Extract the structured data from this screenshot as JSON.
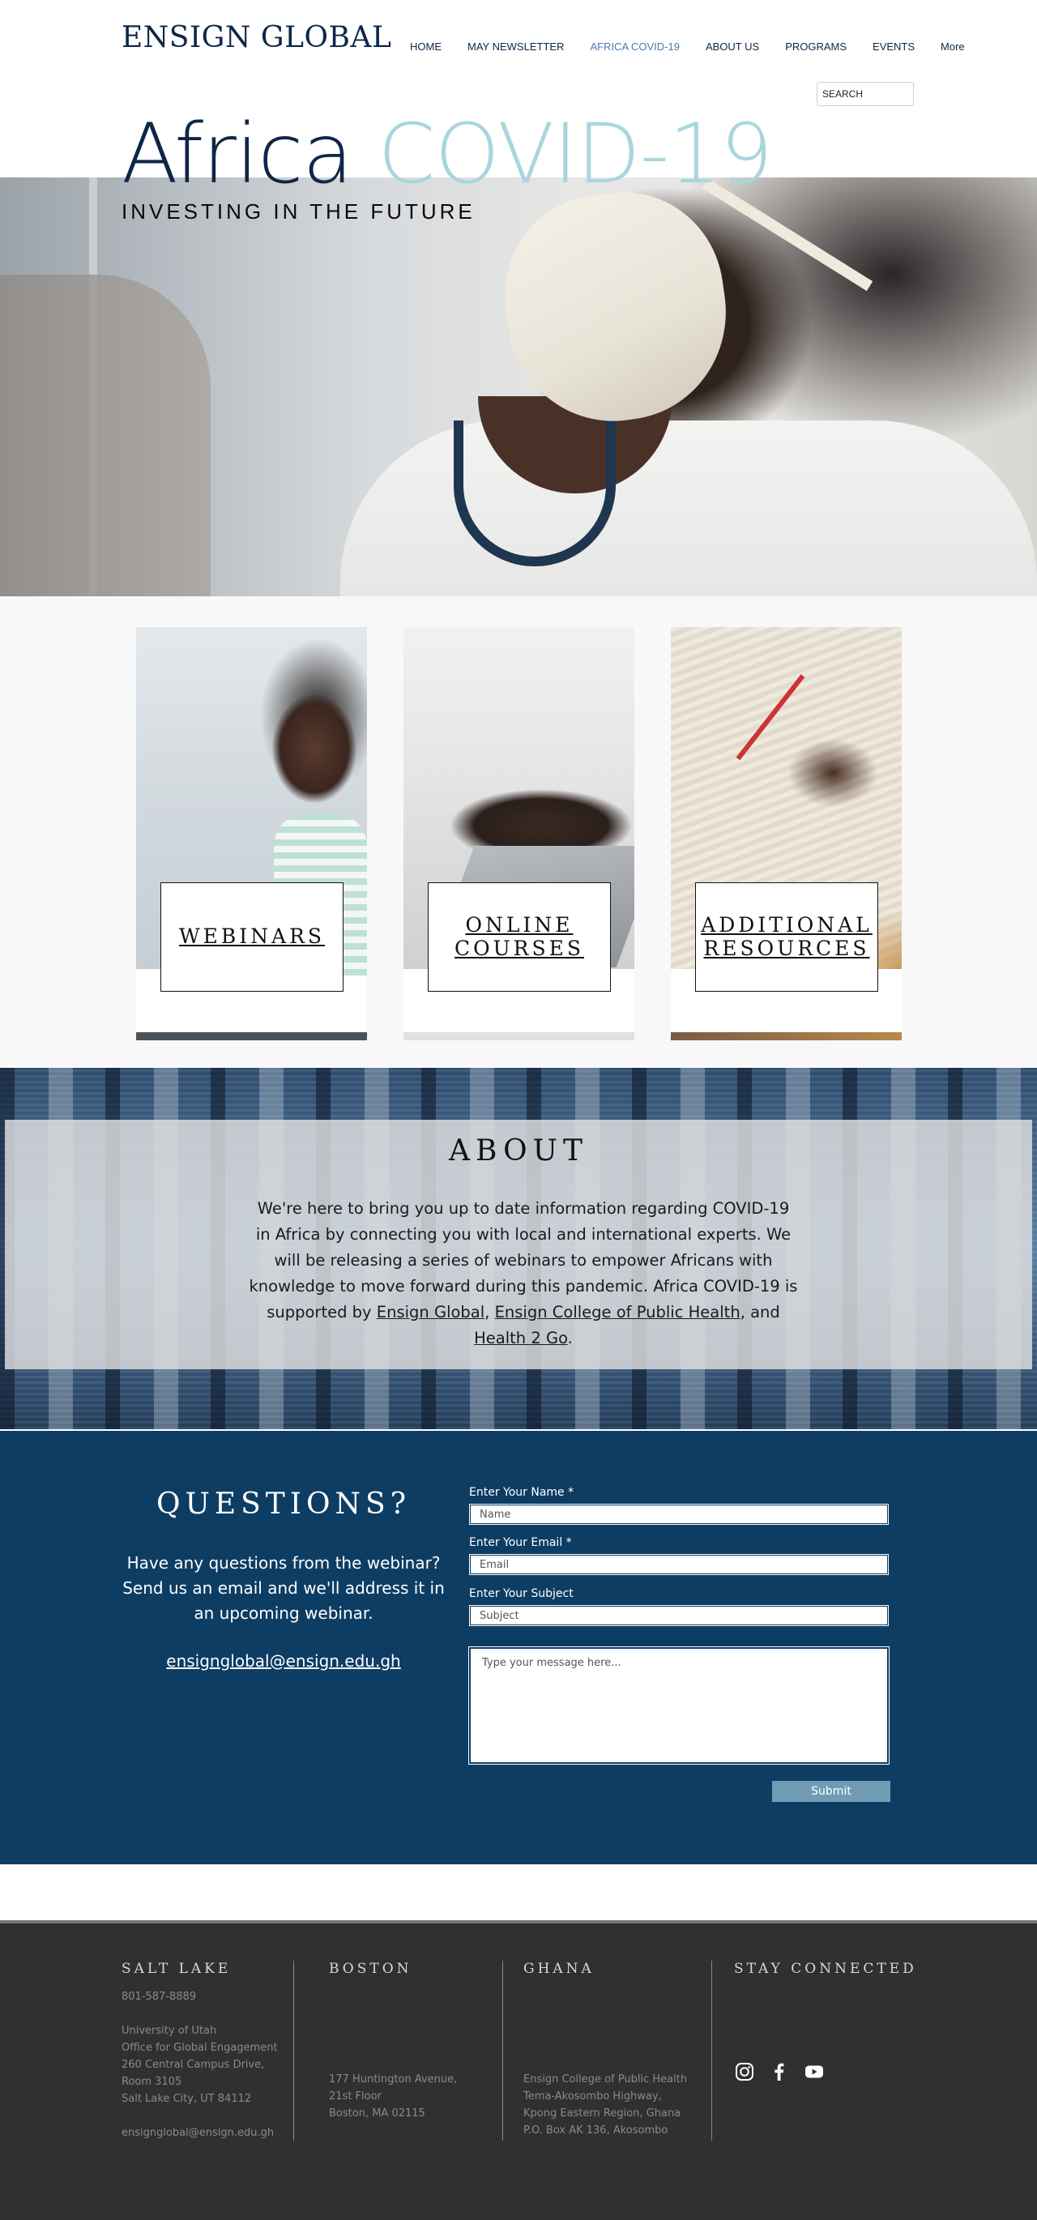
{
  "header": {
    "logo": "ENSIGN GLOBAL",
    "nav": [
      {
        "label": "HOME",
        "active": false
      },
      {
        "label": "MAY NEWSLETTER",
        "active": false
      },
      {
        "label": "AFRICA COVID-19",
        "active": true
      },
      {
        "label": "ABOUT US",
        "active": false
      },
      {
        "label": "PROGRAMS",
        "active": false
      },
      {
        "label": "EVENTS",
        "active": false
      },
      {
        "label": "More",
        "active": false
      }
    ],
    "search_placeholder": "SEARCH"
  },
  "hero": {
    "title_part1": "Africa",
    "title_part2": "COVID-19",
    "subtitle": "INVESTING IN THE FUTURE"
  },
  "cards": [
    {
      "label_line1": "WEBINARS",
      "label_line2": ""
    },
    {
      "label_line1": "ONLINE",
      "label_line2": "COURSES"
    },
    {
      "label_line1": "ADDITIONAL",
      "label_line2": "RESOURCES"
    }
  ],
  "about": {
    "title": "ABOUT",
    "text": "We're here to bring you up to date information regarding COVID-19 in Africa by connecting you with local and international experts. We will be releasing a series of webinars to empower Africans with knowledge to move forward during this pandemic. Africa COVID-19 is supported by",
    "link1": "Ensign Global",
    "sep1": ",",
    "link2": "Ensign College of Public Health",
    "sep2": ", and",
    "link3": "Health 2 Go",
    "end": "."
  },
  "questions": {
    "title": "QUESTIONS?",
    "text": "Have any questions from the webinar? Send us an email and we'll address it in an upcoming webinar.",
    "email": "ensignglobal@ensign.edu.gh",
    "form": {
      "name_label": "Enter Your Name *",
      "name_placeholder": "Name",
      "email_label": "Enter Your Email *",
      "email_placeholder": "Email",
      "subject_label": "Enter Your Subject",
      "subject_placeholder": "Subject",
      "message_placeholder": "Type your message here...",
      "submit": "Submit"
    }
  },
  "footer": {
    "salt_lake": {
      "heading": "SALT LAKE",
      "phone": "801-587-8889",
      "address": [
        "University of Utah",
        "Office for Global Engagement",
        "260 Central Campus Drive,",
        "Room 3105",
        "Salt Lake City, UT 84112"
      ],
      "email": "ensignglobal@ensign.edu.gh"
    },
    "boston": {
      "heading": "BOSTON",
      "address": [
        "177 Huntington Avenue,",
        "21st Floor",
        "Boston, MA 02115"
      ]
    },
    "ghana": {
      "heading": "GHANA",
      "address": [
        "Ensign College of Public Health",
        "Tema-Akosombo Highway,",
        "Kpong Eastern Region, Ghana",
        "P.O. Box AK 136, Akosombo"
      ]
    },
    "stay_connected": {
      "heading": "STAY CONNECTED",
      "icons": [
        "instagram-icon",
        "facebook-icon",
        "youtube-icon"
      ]
    }
  }
}
